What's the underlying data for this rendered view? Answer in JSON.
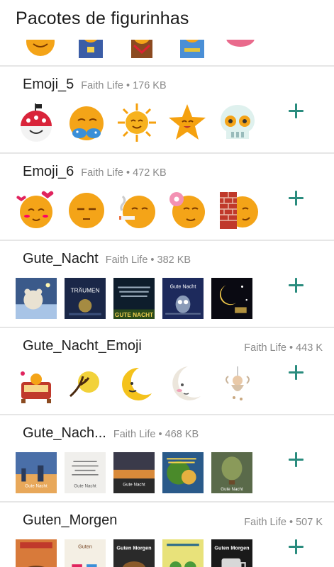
{
  "header": {
    "title": "Pacotes de figurinhas"
  },
  "packs": [
    {
      "name": "Emoji_5",
      "author": "Faith Life",
      "size": "176 KB",
      "meta_align": "left",
      "stickers": [
        "helmet-emoji-icon",
        "bikini-emoji-icon",
        "sun-emoji-icon",
        "star-emoji-icon",
        "skull-emoji-icon"
      ]
    },
    {
      "name": "Emoji_6",
      "author": "Faith Life",
      "size": "472 KB",
      "meta_align": "left",
      "stickers": [
        "love-emoji-icon",
        "sleepy-emoji-icon",
        "cigar-emoji-icon",
        "donut-emoji-icon",
        "brick-wall-emoji-icon"
      ]
    },
    {
      "name": "Gute_Nacht",
      "author": "Faith Life",
      "size": "382 KB",
      "meta_align": "left",
      "stickers": [
        "teddy-night-image",
        "traeumen-night-image",
        "gute-nacht-text-image",
        "owl-night-image",
        "moon-night-image"
      ],
      "texts": [
        "",
        "TRÄUMEN",
        "GUTE NACHT",
        "Gute Nacht",
        ""
      ]
    },
    {
      "name": "Gute_Nacht_Emoji",
      "author": "Faith Life",
      "size": "443 K",
      "meta_align": "right",
      "stickers": [
        "cradle-sticker-icon",
        "moon-tree-sticker-icon",
        "crescent-moon-icon",
        "moon-face-icon",
        "fairy-sticker-icon"
      ]
    },
    {
      "name": "Gute_Nach...",
      "author": "Faith Life",
      "size": "468 KB",
      "meta_align": "left",
      "stickers": [
        "city-night-image",
        "quote-card-image",
        "sunset-night-image",
        "tree-night-image",
        "balloon-night-image"
      ],
      "texts": [
        "Gute Nacht",
        "Gute Nacht",
        "Gute Nacht",
        "",
        "Gute Nacht"
      ]
    },
    {
      "name": "Guten_Morgen",
      "author": "Faith Life",
      "size": "507 K",
      "meta_align": "right",
      "stickers": [
        "coffee-morning-image",
        "cups-morning-image",
        "guten-morgen-image",
        "flowers-morning-image",
        "mug-morning-image"
      ],
      "texts": [
        "",
        "Guten",
        "Guten Morgen",
        "",
        "Guten Morgen"
      ]
    }
  ],
  "separator": "•",
  "colors": {
    "accent": "#2a8c7e",
    "divider": "#e6e6e6",
    "meta": "#8a8a8a"
  }
}
